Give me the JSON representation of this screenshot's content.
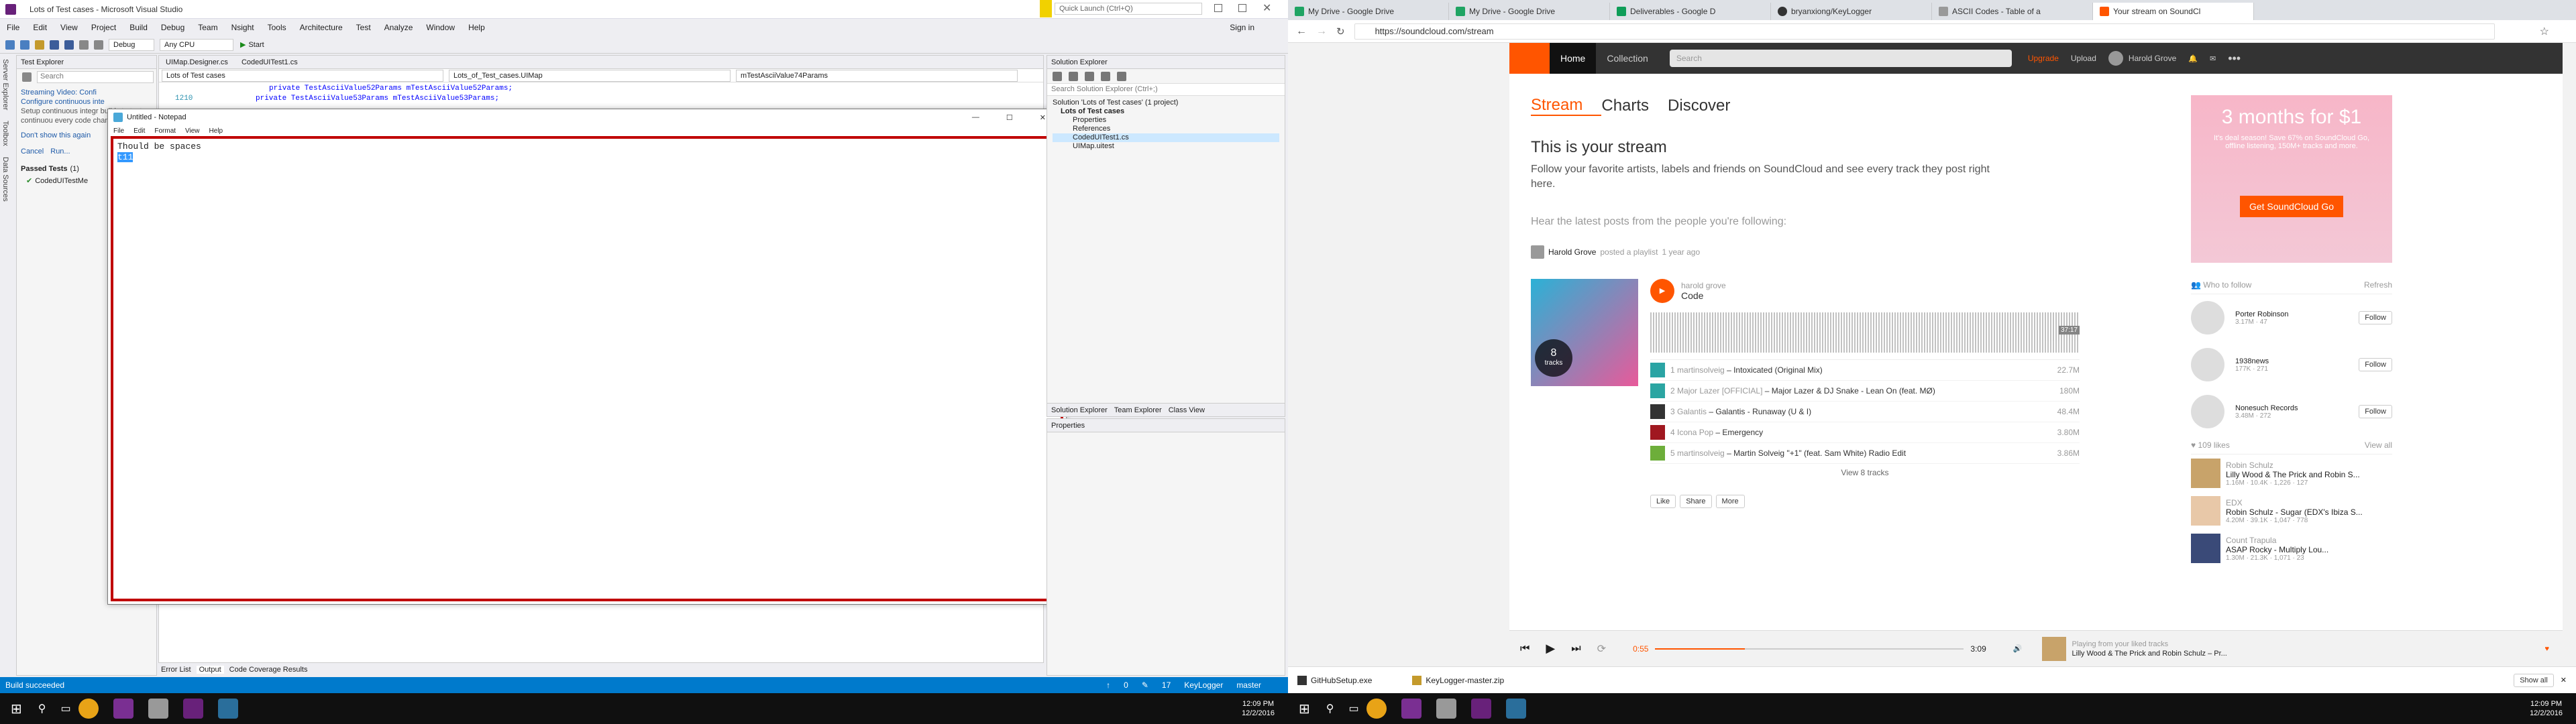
{
  "vs": {
    "title": "Lots of Test cases - Microsoft Visual Studio",
    "quick_launch_placeholder": "Quick Launch (Ctrl+Q)",
    "sign_in": "Sign in",
    "menu": [
      "File",
      "Edit",
      "View",
      "Project",
      "Build",
      "Debug",
      "Team",
      "Nsight",
      "Tools",
      "Architecture",
      "Test",
      "Analyze",
      "Window",
      "Help"
    ],
    "toolbar": {
      "config": "Debug",
      "platform": "Any CPU",
      "start": "Start"
    },
    "side_tabs": [
      "Server Explorer",
      "Toolbox",
      "Data Sources"
    ],
    "test_explorer": {
      "title": "Test Explorer",
      "search_placeholder": "Search",
      "banner_title": "Streaming Video: Confi",
      "banner_text": "Configure continuous inte",
      "banner_body": "Setup continuous integr builds to test continuou every code change.",
      "dont_show": "Don't show this again",
      "run_links": [
        "Cancel",
        "Run..."
      ],
      "passed_header": "Passed Tests",
      "passed_count": "(1)",
      "passed_item": "CodedUITestMe"
    },
    "editor_tabs": [
      "UIMap.Designer.cs",
      "CodedUITest1.cs"
    ],
    "editor_nav": [
      "Lots of Test cases",
      "Lots_of_Test_cases.UIMap",
      "mTestAsciiValue74Params"
    ],
    "code_lines": [
      {
        "num": "",
        "text": "private TestAsciiValue52Params mTestAsciiValue52Params;"
      },
      {
        "num": "1210",
        "text": "private TestAsciiValue53Params mTestAsciiValue53Params;"
      }
    ],
    "notepad": {
      "title": "Untitled - Notepad",
      "menu": [
        "File",
        "Edit",
        "Format",
        "View",
        "Help"
      ],
      "line1": "Thould be spaces",
      "line2": "t11"
    },
    "solution": {
      "title": "Solution Explorer",
      "search_placeholder": "Search Solution Explorer (Ctrl+;)",
      "items": [
        "Solution 'Lots of Test cases' (1 project)",
        "Lots of Test cases",
        "Properties",
        "References",
        "CodedUITest1.cs",
        "UIMap.uitest"
      ],
      "tabs": [
        "Solution Explorer",
        "Team Explorer",
        "Class View"
      ],
      "properties_title": "Properties"
    },
    "bottom_tabs": [
      "Error List",
      "Output",
      "Code Coverage Results"
    ],
    "status": {
      "left": "Build succeeded",
      "branch": "master",
      "repo": "KeyLogger",
      "up": "0",
      "pen": "17"
    },
    "taskbar_time": "12:09 PM",
    "taskbar_date": "12/2/2016"
  },
  "chrome": {
    "tabs": [
      "My Drive - Google Drive",
      "My Drive - Google Drive",
      "Deliverables - Google D",
      "bryanxiong/KeyLogger",
      "ASCII Codes - Table of a",
      "Your stream on SoundCl"
    ],
    "url": "https://soundcloud.com/stream",
    "downloads": [
      "GitHubSetup.exe",
      "KeyLogger-master.zip"
    ],
    "show_all": "Show all",
    "taskbar_time": "12:09 PM",
    "taskbar_date": "12/2/2016"
  },
  "soundcloud": {
    "nav": [
      "Home",
      "Collection"
    ],
    "search_placeholder": "Search",
    "upgrade": "Upgrade",
    "upload": "Upload",
    "user": "Harold Grove",
    "subnav": [
      "Stream",
      "Charts",
      "Discover"
    ],
    "heading": "This is your stream",
    "intro": "Follow your favorite artists, labels and friends on SoundCloud and see every track they post right here.",
    "hear": "Hear the latest posts from the people you're following:",
    "post_user": "Harold Grove",
    "post_action": "posted a playlist",
    "post_time": "1 year ago",
    "playlist_owner": "harold grove",
    "playlist_title": "Code",
    "playlist_count": "8",
    "playlist_count_label": "tracks",
    "duration": "37:17",
    "tracks": [
      {
        "n": "1",
        "artist": "martinsolveig",
        "title": "Intoxicated (Original Mix)",
        "plays": "22.7M"
      },
      {
        "n": "2",
        "artist": "Major Lazer [OFFICIAL]",
        "title": "Major Lazer & DJ Snake - Lean On (feat. MØ)",
        "plays": "180M"
      },
      {
        "n": "3",
        "artist": "Galantis",
        "title": "Galantis - Runaway (U & I)",
        "plays": "48.4M"
      },
      {
        "n": "4",
        "artist": "Icona Pop",
        "title": "Emergency",
        "plays": "3.80M"
      },
      {
        "n": "5",
        "artist": "martinsolveig",
        "title": "Martin Solveig \"+1\" (feat. Sam White) Radio Edit",
        "plays": "3.86M"
      }
    ],
    "view_tracks": "View 8 tracks",
    "actions": [
      "Like",
      "Share",
      "More"
    ],
    "ad_headline": "3 months for $1",
    "ad_sub": "It's deal season! Save 67% on SoundCloud Go, offline listening, 150M+ tracks and more.",
    "ad_button": "Get SoundCloud Go",
    "who_to_follow": "Who to follow",
    "refresh": "Refresh",
    "follow": "Follow",
    "suggestions": [
      {
        "name": "Porter Robinson",
        "f1": "3.17M",
        "f2": "47"
      },
      {
        "name": "1938news",
        "f1": "177K",
        "f2": "271"
      },
      {
        "name": "Nonesuch Records",
        "f1": "3.48M",
        "f2": "272"
      }
    ],
    "likes_header": "109 likes",
    "view_all": "View all",
    "likes": [
      {
        "user": "Robin Schulz",
        "title": "Lilly Wood & The Prick and Robin S...",
        "s": "1.16M · 10.4K · 1,226 · 127"
      },
      {
        "user": "EDX",
        "title": "Robin Schulz - Sugar (EDX's Ibiza S...",
        "s": "4.20M · 39.1K · 1,047 · 778"
      },
      {
        "user": "Count Trapula",
        "title": "ASAP Rocky - Multiply Lou...",
        "s": "1.30M · 21.3K · 1,071 · 23"
      }
    ],
    "player": {
      "elapsed": "0:55",
      "total": "3:09",
      "progress": 0.29,
      "source": "Playing from your liked tracks",
      "now": "Lilly Wood & The Prick and Robin Schulz – Pr..."
    }
  },
  "colors": {
    "accent": "#f50",
    "vs_blue": "#007acc",
    "notepad_border": "#c00000"
  }
}
